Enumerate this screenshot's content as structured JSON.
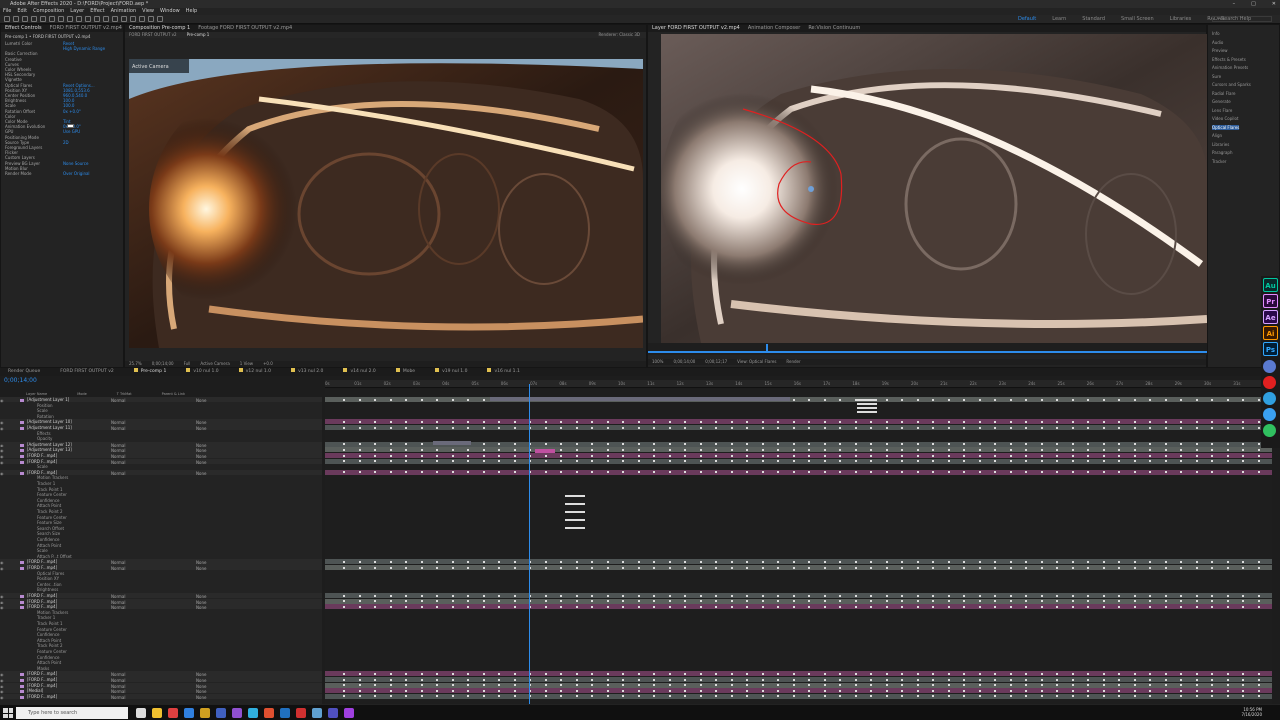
{
  "window": {
    "title": "Adobe After Effects 2020 - D:\\FORD\\Project\\FORD.aep *"
  },
  "menu": [
    "File",
    "Edit",
    "Composition",
    "Layer",
    "Effect",
    "Animation",
    "View",
    "Window",
    "Help"
  ],
  "workspaces": [
    "Default",
    "Learn",
    "Standard",
    "Small Screen",
    "Libraries",
    "RADAR"
  ],
  "search_placeholder": "Search Help",
  "effects_panel": {
    "tabs": [
      "Effect Controls",
      "FORD FIRST OUTPUT v2.mp4"
    ],
    "header": "Pre-comp 1 • FORD FIRST OUTPUT v2.mp4",
    "lines": [
      {
        "label": "Lumetri Color",
        "value": "Reset"
      },
      {
        "label": "",
        "value": "High Dynamic Range"
      },
      {
        "label": "Basic Correction",
        "value": ""
      },
      {
        "label": "Creative",
        "value": ""
      },
      {
        "label": "Curves",
        "value": ""
      },
      {
        "label": "Color Wheels",
        "value": ""
      },
      {
        "label": "HSL Secondary",
        "value": ""
      },
      {
        "label": "Vignette",
        "value": ""
      },
      {
        "label": "Optical Flares",
        "value": "Reset  Options..."
      },
      {
        "label": "Position XY",
        "value": "1081.0,553.6"
      },
      {
        "label": "Center Position",
        "value": "960.0,540.0"
      },
      {
        "label": "Brightness",
        "value": "100.0"
      },
      {
        "label": "Scale",
        "value": "100.0"
      },
      {
        "label": "Rotation Offset",
        "value": "0x +0.0°"
      },
      {
        "label": "Color",
        "value": ""
      },
      {
        "label": "Color Mode",
        "value": "Tint"
      },
      {
        "label": "Animation Evolution",
        "value": "0x +0.0°"
      },
      {
        "label": "GPU",
        "value": "Use GPU"
      },
      {
        "label": "Positioning Mode",
        "value": ""
      },
      {
        "label": "Source Type",
        "value": "2D"
      },
      {
        "label": "Foreground Layers",
        "value": ""
      },
      {
        "label": "Flicker",
        "value": ""
      },
      {
        "label": "Custom Layers",
        "value": ""
      },
      {
        "label": "Preview BG Layer",
        "value": "None  Source"
      },
      {
        "label": "Motion Blur",
        "value": ""
      },
      {
        "label": "Render Mode",
        "value": "Over Original"
      }
    ]
  },
  "comp_panel": {
    "tabs": [
      "Composition Pre-comp 1",
      "Footage FORD FIRST OUTPUT v2.mp4"
    ],
    "sub_tabs": [
      "FORD FIRST OUTPUT v2",
      "Pre-comp 1"
    ],
    "renderer": "Renderer: Classic 3D",
    "active_camera": "Active Camera",
    "footer": [
      "25.7%",
      "0;00;14;00",
      "Full",
      "Active Camera",
      "1 View",
      "+0.0"
    ]
  },
  "footage_panel": {
    "tabs": [
      "Layer FORD FIRST OUTPUT v2.mp4",
      "Animation Composer",
      "Re:Vision Continuum"
    ],
    "footer": [
      "100%",
      "0;00;14;00",
      "0;00;12;17",
      "View: Optical Flares",
      "Render"
    ]
  },
  "right_panel": {
    "items": [
      "Info",
      "Audio",
      "Preview",
      "Effects & Presets",
      "Animation Presets",
      "Sure",
      "Cursors and Sparks",
      "Radial Flare",
      "Generate",
      "Lens Flare",
      "Video Copilot",
      "Optical Flares",
      "Align",
      "Libraries",
      "Paragraph",
      "Tracker"
    ]
  },
  "timeline": {
    "tabs": [
      "Render Queue",
      "FORD FIRST OUTPUT v2",
      "Pre-comp 1",
      "v10 nul 1.0",
      "v12 nul 1.0",
      "v13 nul 2.0",
      "v14 nul 2.0",
      "Mobe",
      "v19 nul 1.0",
      "v16 nul 1.1"
    ],
    "timecode": "0;00;14;00",
    "columns": [
      "Layer Name",
      "Mode",
      "T TrkMat",
      "Parent & Link"
    ],
    "ruler": [
      "0s",
      "01s",
      "02s",
      "03s",
      "04s",
      "05s",
      "06s",
      "07s",
      "08s",
      "09s",
      "10s",
      "11s",
      "12s",
      "13s",
      "14s",
      "15s",
      "16s",
      "17s",
      "18s",
      "19s",
      "20s",
      "21s",
      "22s",
      "23s",
      "24s",
      "25s",
      "26s",
      "27s",
      "28s",
      "29s",
      "30s",
      "31s"
    ],
    "rows": [
      {
        "name": "[Adjustment Layer 1]",
        "mode": "Normal",
        "parent": "None",
        "kind": "layer"
      },
      {
        "name": "Position",
        "mode": "",
        "parent": "",
        "kind": "prop"
      },
      {
        "name": "Scale",
        "mode": "",
        "parent": "",
        "kind": "prop"
      },
      {
        "name": "Rotation",
        "mode": "",
        "parent": "",
        "kind": "prop"
      },
      {
        "name": "[Adjustment Layer 10]",
        "mode": "Normal",
        "parent": "None",
        "kind": "layer"
      },
      {
        "name": "[Adjustment Layer 11]",
        "mode": "Normal",
        "parent": "None",
        "kind": "layer"
      },
      {
        "name": "Effects",
        "mode": "",
        "parent": "",
        "kind": "prop"
      },
      {
        "name": "Opacity",
        "mode": "",
        "parent": "",
        "kind": "prop"
      },
      {
        "name": "[Adjustment Layer 12]",
        "mode": "Normal",
        "parent": "None",
        "kind": "layer"
      },
      {
        "name": "[Adjustment Layer 13]",
        "mode": "Normal",
        "parent": "None",
        "kind": "layer"
      },
      {
        "name": "[FORD F...mp4]",
        "mode": "Normal",
        "parent": "None",
        "kind": "layer"
      },
      {
        "name": "[FORD F...mp4]",
        "mode": "Normal",
        "parent": "None",
        "kind": "layer"
      },
      {
        "name": "Scale",
        "mode": "",
        "parent": "",
        "kind": "prop"
      },
      {
        "name": "[FORD F...mp4]",
        "mode": "Normal",
        "parent": "None",
        "kind": "layer"
      },
      {
        "name": "Motion Trackers",
        "mode": "",
        "parent": "",
        "kind": "prop"
      },
      {
        "name": "Tracker 1",
        "mode": "",
        "parent": "",
        "kind": "prop"
      },
      {
        "name": "Track Point 1",
        "mode": "",
        "parent": "",
        "kind": "prop"
      },
      {
        "name": "Feature Center",
        "mode": "",
        "parent": "",
        "kind": "prop"
      },
      {
        "name": "Confidence",
        "mode": "",
        "parent": "",
        "kind": "prop"
      },
      {
        "name": "Attach Point",
        "mode": "",
        "parent": "",
        "kind": "prop"
      },
      {
        "name": "Track Point 2",
        "mode": "",
        "parent": "",
        "kind": "prop"
      },
      {
        "name": "Feature Center",
        "mode": "",
        "parent": "",
        "kind": "prop"
      },
      {
        "name": "Feature Size",
        "mode": "",
        "parent": "",
        "kind": "prop"
      },
      {
        "name": "Search Offset",
        "mode": "",
        "parent": "",
        "kind": "prop"
      },
      {
        "name": "Search Size",
        "mode": "",
        "parent": "",
        "kind": "prop"
      },
      {
        "name": "Confidence",
        "mode": "",
        "parent": "",
        "kind": "prop"
      },
      {
        "name": "Attach Point",
        "mode": "",
        "parent": "",
        "kind": "prop"
      },
      {
        "name": "Scale",
        "mode": "",
        "parent": "",
        "kind": "prop"
      },
      {
        "name": "Attach P...t Offset",
        "mode": "",
        "parent": "",
        "kind": "prop"
      },
      {
        "name": "[FORD F...mp4]",
        "mode": "Normal",
        "parent": "None",
        "kind": "layer"
      },
      {
        "name": "[FORD F...mp4]",
        "mode": "Normal",
        "parent": "None",
        "kind": "layer"
      },
      {
        "name": "Optical Flares",
        "mode": "",
        "parent": "",
        "kind": "prop"
      },
      {
        "name": "Position XY",
        "mode": "",
        "parent": "",
        "kind": "prop"
      },
      {
        "name": "Center...tion",
        "mode": "",
        "parent": "",
        "kind": "prop"
      },
      {
        "name": "Brightness",
        "mode": "",
        "parent": "",
        "kind": "prop"
      },
      {
        "name": "[FORD F...mp4]",
        "mode": "Normal",
        "parent": "None",
        "kind": "layer"
      },
      {
        "name": "[FORD F...mp4]",
        "mode": "Normal",
        "parent": "None",
        "kind": "layer"
      },
      {
        "name": "[FORD F...mp4]",
        "mode": "Normal",
        "parent": "None",
        "kind": "layer"
      },
      {
        "name": "Motion Trackers",
        "mode": "",
        "parent": "",
        "kind": "prop"
      },
      {
        "name": "Tracker 1",
        "mode": "",
        "parent": "",
        "kind": "prop"
      },
      {
        "name": "Track Point 1",
        "mode": "",
        "parent": "",
        "kind": "prop"
      },
      {
        "name": "Feature Center",
        "mode": "",
        "parent": "",
        "kind": "prop"
      },
      {
        "name": "Confidence",
        "mode": "",
        "parent": "",
        "kind": "prop"
      },
      {
        "name": "Attach Point",
        "mode": "",
        "parent": "",
        "kind": "prop"
      },
      {
        "name": "Track Point 2",
        "mode": "",
        "parent": "",
        "kind": "prop"
      },
      {
        "name": "Feature Center",
        "mode": "",
        "parent": "",
        "kind": "prop"
      },
      {
        "name": "Confidence",
        "mode": "",
        "parent": "",
        "kind": "prop"
      },
      {
        "name": "Attach Point",
        "mode": "",
        "parent": "",
        "kind": "prop"
      },
      {
        "name": "Masks",
        "mode": "",
        "parent": "",
        "kind": "prop"
      },
      {
        "name": "[FORD F...mp4]",
        "mode": "Normal",
        "parent": "None",
        "kind": "layer"
      },
      {
        "name": "[FORD F...mp4]",
        "mode": "Normal",
        "parent": "None",
        "kind": "layer"
      },
      {
        "name": "[FORD F...mp4]",
        "mode": "Normal",
        "parent": "None",
        "kind": "layer"
      },
      {
        "name": "[Medial]",
        "mode": "Normal",
        "parent": "None",
        "kind": "layer"
      },
      {
        "name": "[FORD F...mp4]",
        "mode": "Normal",
        "parent": "None",
        "kind": "layer"
      }
    ]
  },
  "dock_apps": [
    {
      "label": "Au",
      "color": "#00c8a0",
      "bg": "#0a2a2a"
    },
    {
      "label": "Pr",
      "color": "#e38cff",
      "bg": "#2a0a3a"
    },
    {
      "label": "Ae",
      "color": "#d4a2ff",
      "bg": "#2a0a4a"
    },
    {
      "label": "Ai",
      "color": "#ff9a00",
      "bg": "#3a1a00"
    },
    {
      "label": "Ps",
      "color": "#31a8ff",
      "bg": "#001e36"
    }
  ],
  "taskbar": {
    "search_placeholder": "Type here to search",
    "time": "10:56 PM",
    "date": "7/16/2020"
  }
}
